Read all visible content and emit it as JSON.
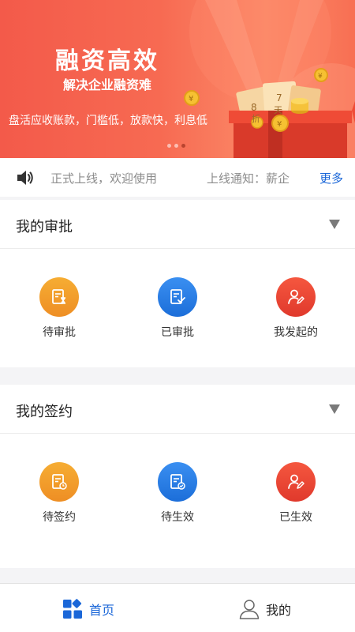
{
  "banner": {
    "title": "融资高效",
    "subtitle": "解决企业融资难",
    "description": "盘活应收账款，门槛低，放款快，利息低",
    "ticket_text_1": "8",
    "ticket_text_2": "7",
    "ticket_text_3": "天",
    "ticket_text_4": "折",
    "coin_symbol": "¥",
    "slides_total": 3,
    "active_slide": 3
  },
  "notice": {
    "icon": "speaker-icon",
    "text_1": "正式上线，欢迎使用",
    "text_2": "上线通知：薪企",
    "more_label": "更多"
  },
  "approval_section": {
    "title": "我的审批",
    "collapse_icon": "triangle-down-icon",
    "items": [
      {
        "label": "待审批",
        "icon": "pending-document-icon",
        "color": "#f0982a"
      },
      {
        "label": "已审批",
        "icon": "approved-document-icon",
        "color": "#2a7fe6"
      },
      {
        "label": "我发起的",
        "icon": "user-edit-icon",
        "color": "#ea4632"
      }
    ]
  },
  "sign_section": {
    "title": "我的签约",
    "collapse_icon": "triangle-down-icon",
    "items": [
      {
        "label": "待签约",
        "icon": "document-clock-icon",
        "color": "#f0982a"
      },
      {
        "label": "待生效",
        "icon": "document-check-icon",
        "color": "#2a7fe6"
      },
      {
        "label": "已生效",
        "icon": "user-edit-icon",
        "color": "#ea4632"
      }
    ]
  },
  "bottom_nav": {
    "home_label": "首页",
    "home_icon": "grid-icon",
    "mine_label": "我的",
    "mine_icon": "user-outline-icon",
    "active_color": "#1b67d8"
  }
}
